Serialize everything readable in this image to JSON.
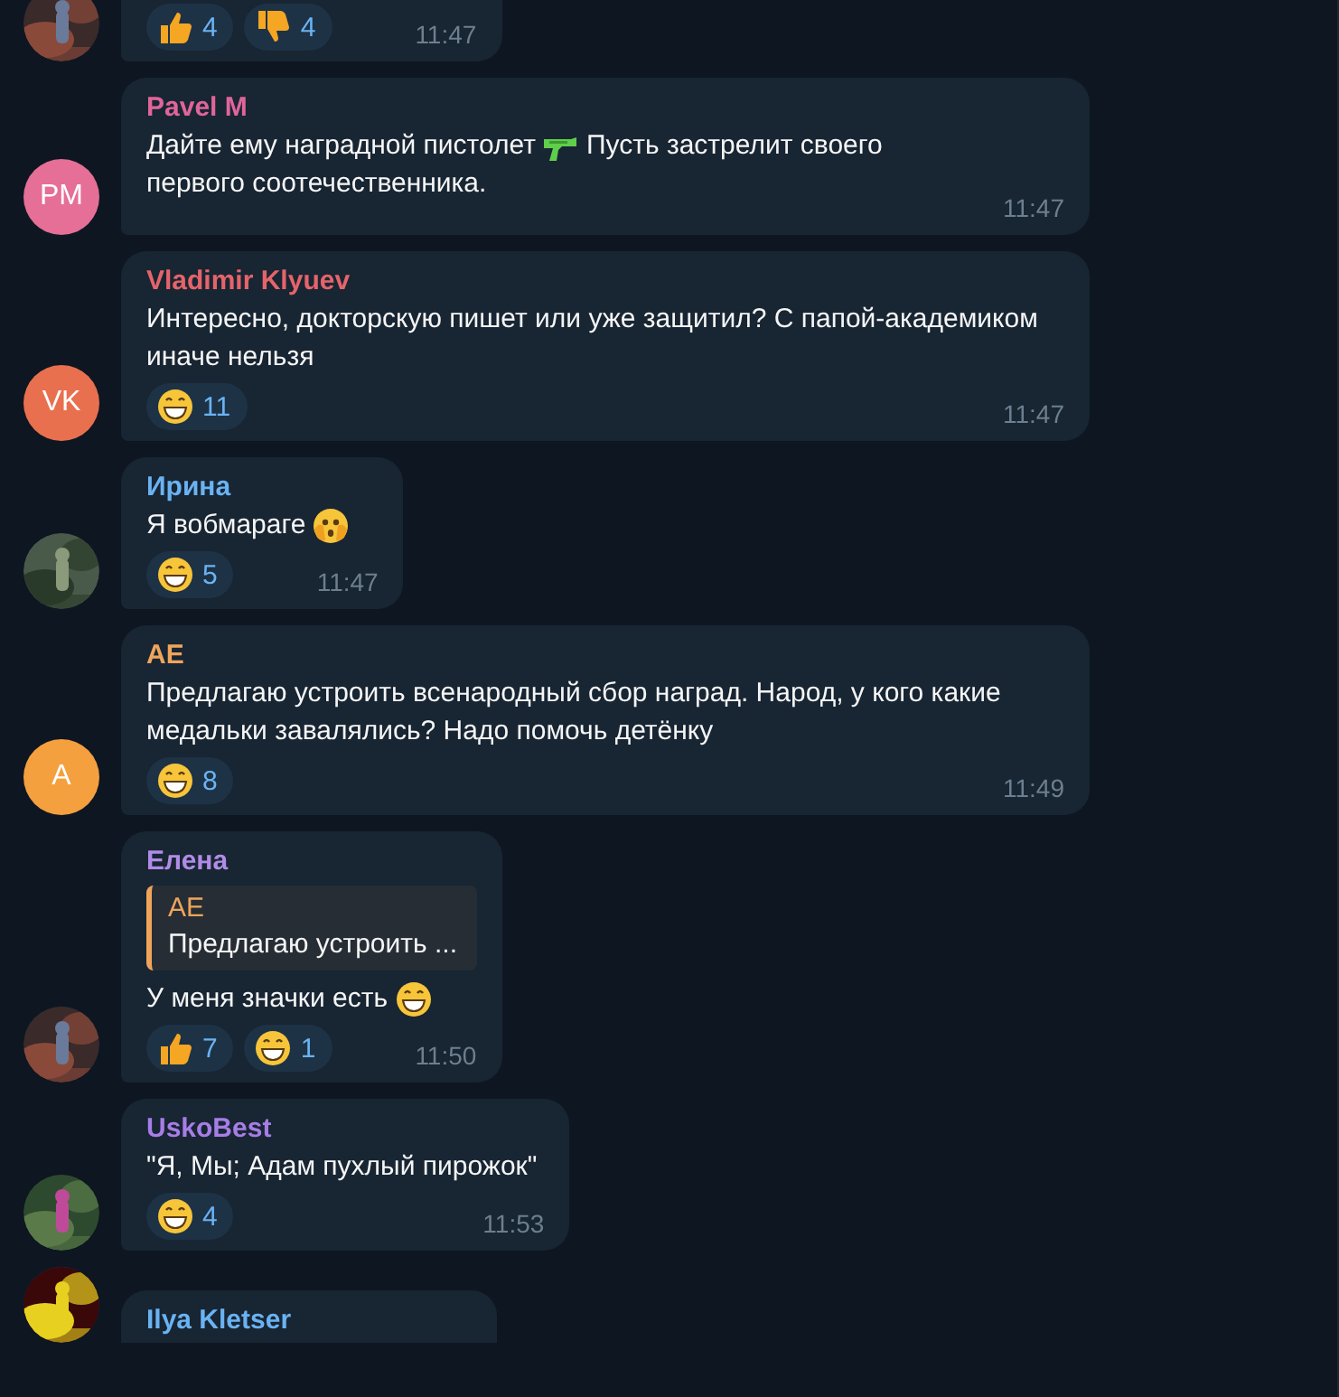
{
  "messages": [
    {
      "avatar": {
        "kind": "picture"
      },
      "cut_top": true,
      "reactions": [
        {
          "kind": "thumbs-up",
          "count": "4"
        },
        {
          "kind": "thumbs-down",
          "count": "4"
        }
      ],
      "time": "11:47"
    },
    {
      "avatar": {
        "kind": "initials",
        "text": "PM",
        "color": "#e56f97"
      },
      "name": "Pavel M",
      "color": "#e0659a",
      "body": [
        {
          "kind": "text",
          "text": "Дайте ему наградной пистолет"
        },
        {
          "kind": "gun"
        },
        {
          "kind": "text",
          "text": "Пусть застрелит своего"
        },
        {
          "kind": "text",
          "text": "первого соотечественника."
        }
      ],
      "time": "11:47"
    },
    {
      "avatar": {
        "kind": "initials",
        "text": "VK",
        "color": "#e8704f"
      },
      "name": "Vladimir Klyuev",
      "color": "#e5646a",
      "body": [
        {
          "kind": "text",
          "text": "Интересно, докторскую пишет или уже защитил? С папой-академиком иначе нельзя"
        }
      ],
      "reactions": [
        {
          "kind": "grin",
          "count": "11"
        }
      ],
      "time": "11:47"
    },
    {
      "avatar": {
        "kind": "picture"
      },
      "name": "Ирина",
      "color": "#6ab3f3",
      "body": [
        {
          "kind": "text",
          "text": "Я вобмараге"
        },
        {
          "kind": "covered"
        }
      ],
      "reactions": [
        {
          "kind": "grin",
          "count": "5"
        }
      ],
      "time": "11:47"
    },
    {
      "avatar": {
        "kind": "initials",
        "text": "A",
        "color": "#f4a03f"
      },
      "name": "AE",
      "color": "#eea55b",
      "body": [
        {
          "kind": "text",
          "text": "Предлагаю устроить всенародный сбор наград. Народ, у кого какие медальки завалялись? Надо помочь детёнку"
        }
      ],
      "reactions": [
        {
          "kind": "grin",
          "count": "8"
        }
      ],
      "time": "11:49"
    },
    {
      "avatar": {
        "kind": "picture"
      },
      "name": "Елена",
      "color": "#b08ce6",
      "reply": {
        "name": "AE",
        "text": "Предлагаю устроить ...",
        "color": "#eea55b"
      },
      "body": [
        {
          "kind": "text",
          "text": "У меня значки есть"
        },
        {
          "kind": "grin"
        }
      ],
      "reactions": [
        {
          "kind": "thumbs-up",
          "count": "7"
        },
        {
          "kind": "grin",
          "count": "1"
        }
      ],
      "time": "11:50"
    },
    {
      "avatar": {
        "kind": "picture"
      },
      "name": "UskoBest",
      "color": "#a77de6",
      "body": [
        {
          "kind": "text",
          "text": "\"Я, Мы; Адам пухлый пирожок\""
        }
      ],
      "reactions": [
        {
          "kind": "grin",
          "count": "4"
        }
      ],
      "time": "11:53"
    },
    {
      "avatar": {
        "kind": "picture"
      },
      "cut_bottom": true,
      "name": "Ilya Kletser",
      "color": "#6ab3f3"
    }
  ]
}
